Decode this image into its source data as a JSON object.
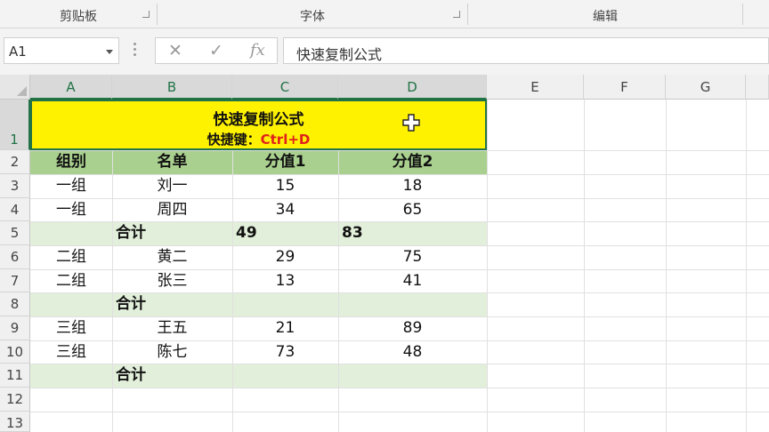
{
  "ribbon": {
    "groups": [
      {
        "label": "剪贴板"
      },
      {
        "label": "字体"
      },
      {
        "label": "编辑"
      }
    ]
  },
  "formula_bar": {
    "name_box": "A1",
    "cancel_icon": "✕",
    "enter_icon": "✓",
    "fx_label": "fx",
    "formula": "快速复制公式"
  },
  "sheet": {
    "columns": [
      "A",
      "B",
      "C",
      "D",
      "E",
      "F",
      "G"
    ],
    "rows": [
      "1",
      "2",
      "3",
      "4",
      "5",
      "6",
      "7",
      "8",
      "9",
      "10",
      "11",
      "12",
      "13"
    ],
    "title": "快速复制公式",
    "shortcut_label": "快捷键：",
    "shortcut_key": "Ctrl+D",
    "header": [
      "组别",
      "名单",
      "分值1",
      "分值2"
    ],
    "data": [
      [
        "一组",
        "刘一",
        "15",
        "18"
      ],
      [
        "一组",
        "周四",
        "34",
        "65"
      ],
      [
        "",
        "合计",
        "49",
        "83"
      ],
      [
        "二组",
        "黄二",
        "29",
        "75"
      ],
      [
        "二组",
        "张三",
        "13",
        "41"
      ],
      [
        "",
        "合计",
        "",
        ""
      ],
      [
        "三组",
        "王五",
        "21",
        "89"
      ],
      [
        "三组",
        "陈七",
        "73",
        "48"
      ],
      [
        "",
        "合计",
        "",
        ""
      ]
    ]
  },
  "colors": {
    "accent": "#217346",
    "title_fill": "#fff200",
    "header_fill": "#a9d08e",
    "subtotal_fill": "#e2efda",
    "shortcut_text": "#e0201c"
  }
}
